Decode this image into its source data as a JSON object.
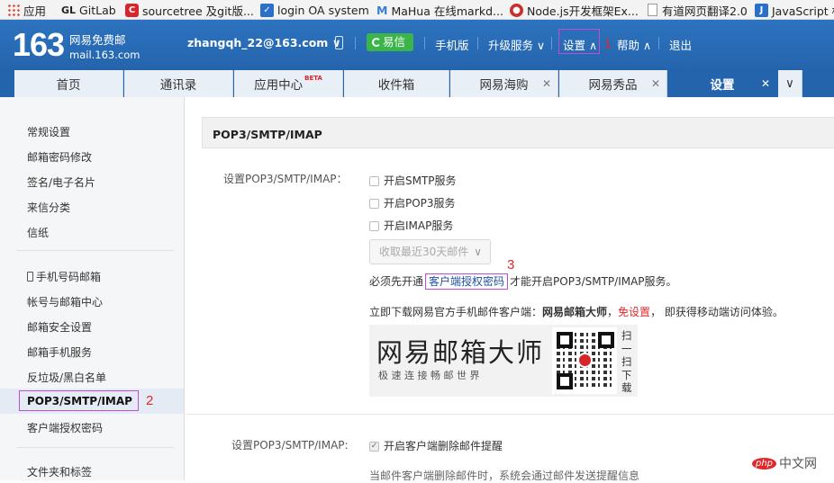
{
  "bookmarks": [
    {
      "label": "应用",
      "icon": "apps-icon"
    },
    {
      "label": "GitLab",
      "prefix": "GL",
      "icon": "gitlab-icon"
    },
    {
      "label": "sourcetree 及git版...",
      "icon": "sourcetree-icon"
    },
    {
      "label": "login OA system",
      "icon": "oa-icon"
    },
    {
      "label": "MaHua 在线markd...",
      "prefix": "M",
      "icon": "mahua-icon"
    },
    {
      "label": "Node.js开发框架Ex...",
      "icon": "node-icon"
    },
    {
      "label": "有道网页翻译2.0",
      "icon": "page-icon"
    },
    {
      "label": "JavaScript 标",
      "prefix": "J",
      "icon": "js-icon"
    }
  ],
  "header": {
    "logo_number": "163",
    "logo_title": "网易免费邮",
    "logo_domain": "mail.163.com",
    "user": "zhangqh_22@163.com ∨",
    "yixin": "易信",
    "mobile": "手机版",
    "upgrade": "升级服务 ∨",
    "settings": "设置 ∧",
    "help": "帮助 ∧",
    "logout": "退出"
  },
  "tabs": [
    {
      "label": "首页",
      "closable": false
    },
    {
      "label": "通讯录",
      "closable": false
    },
    {
      "label": "应用中心",
      "badge": "BETA",
      "closable": false
    },
    {
      "label": "收件箱",
      "closable": false
    },
    {
      "label": "网易海购",
      "closable": true
    },
    {
      "label": "网易秀品",
      "closable": true
    },
    {
      "label": "设置",
      "closable": true,
      "active": true
    }
  ],
  "tabs_more": "∨",
  "sidebar": {
    "group1": [
      "常规设置",
      "邮箱密码修改",
      "签名/电子名片",
      "来信分类",
      "信纸"
    ],
    "group2": [
      "手机号码邮箱",
      "帐号与邮箱中心",
      "邮箱安全设置",
      "邮箱手机服务",
      "反垃圾/黑白名单",
      "POP3/SMTP/IMAP",
      "客户端授权密码"
    ],
    "group3": [
      "文件夹和标签"
    ]
  },
  "main": {
    "section_title": "POP3/SMTP/IMAP",
    "setting_label": "设置POP3/SMTP/IMAP：",
    "options": [
      "开启SMTP服务",
      "开启POP3服务",
      "开启IMAP服务"
    ],
    "dropdown": "收取最近30天邮件",
    "notice_pre": "必须先开通",
    "notice_link": "客户端授权密码",
    "notice_post": "才能开启POP3/SMTP/IMAP服务。",
    "download_pre": "立即下载网易官方手机邮件客户端：",
    "download_app": "网易邮箱大师",
    "download_sep": "，",
    "download_free": "免设置",
    "download_post": "，  即获得移动端访问体验。",
    "banner_title": "网易邮箱大师",
    "banner_sub": "极 速 连 接    畅 邮 世 界",
    "qr_text": "扫一扫下载",
    "setting2_label": "设置POP3/SMTP/IMAP:",
    "option2": "开启客户端删除邮件提醒",
    "desc2": "当邮件客户端删除邮件时，系统会通过邮件发送提醒信息"
  },
  "annotations": {
    "n1": "1",
    "n2": "2",
    "n3": "3"
  },
  "watermark": "中文网",
  "watermark_logo": "php",
  "colors": {
    "header_blue": "#2464ad",
    "active_tab": "#2464ad",
    "annotation": "#c04cd6",
    "annotation_num": "#e0282a",
    "link": "#1e50a2",
    "warn": "#e0282a"
  }
}
